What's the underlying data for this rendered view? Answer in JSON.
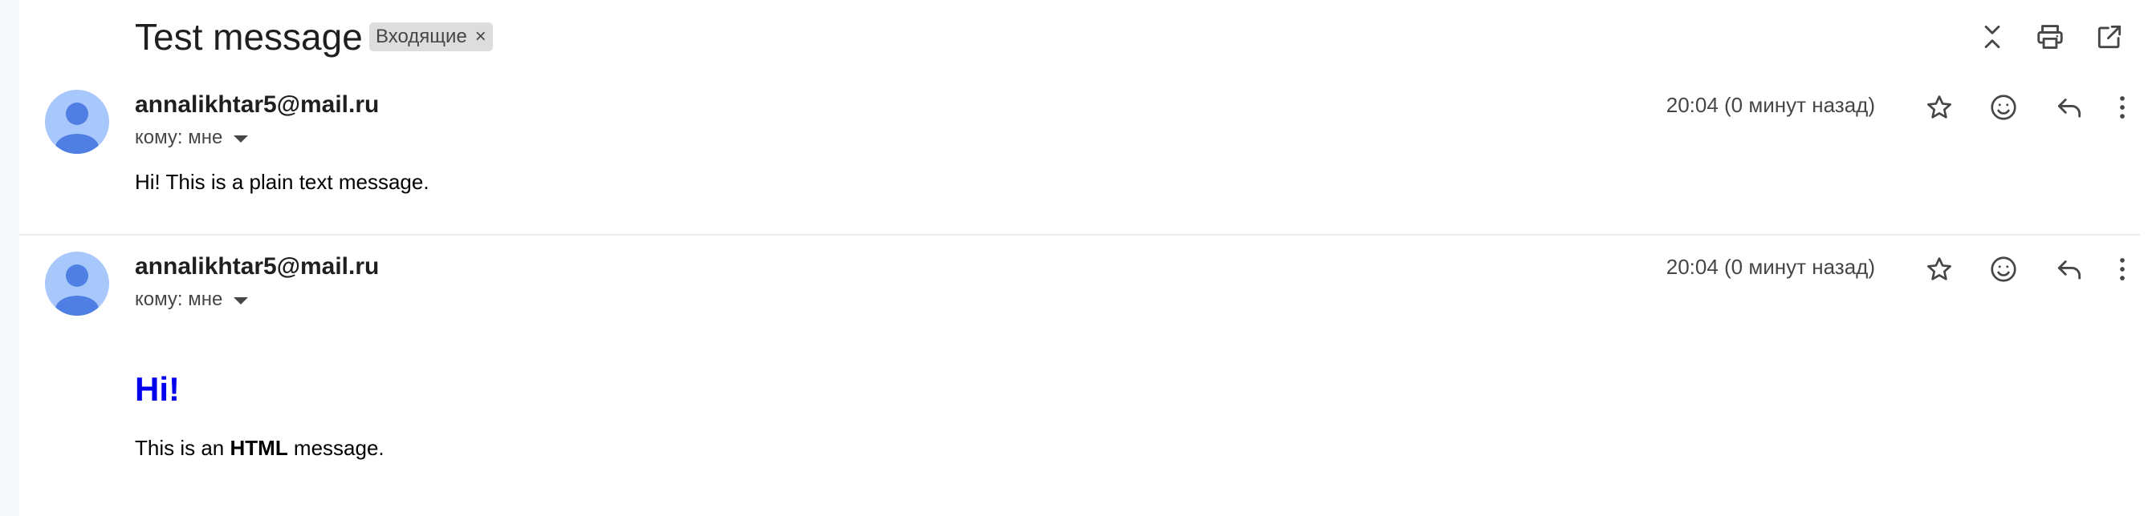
{
  "thread": {
    "subject": "Test message",
    "label": "Входящие",
    "label_close": "×"
  },
  "header_icons": [
    "collapse-all-icon",
    "print-icon",
    "open-in-new-window-icon"
  ],
  "messages": [
    {
      "sender": "annalikhtar5@mail.ru",
      "recipient": "кому: мне",
      "time": "20:04 (0 минут назад)",
      "body": "Hi! This is a plain text message."
    },
    {
      "sender": "annalikhtar5@mail.ru",
      "recipient": "кому: мне",
      "time": "20:04 (0 минут назад)",
      "heading": "Hi!",
      "body_prefix": "This is an ",
      "body_bold": "HTML",
      "body_suffix": " message."
    }
  ],
  "message_icons": [
    "star-icon",
    "emoji-reaction-icon",
    "reply-icon",
    "more-vert-icon"
  ],
  "colors": {
    "avatar_bg": "#a8c7fa",
    "avatar_fg": "#4f7fe3",
    "heading": "#0000ee",
    "label_bg": "#dddddd"
  }
}
